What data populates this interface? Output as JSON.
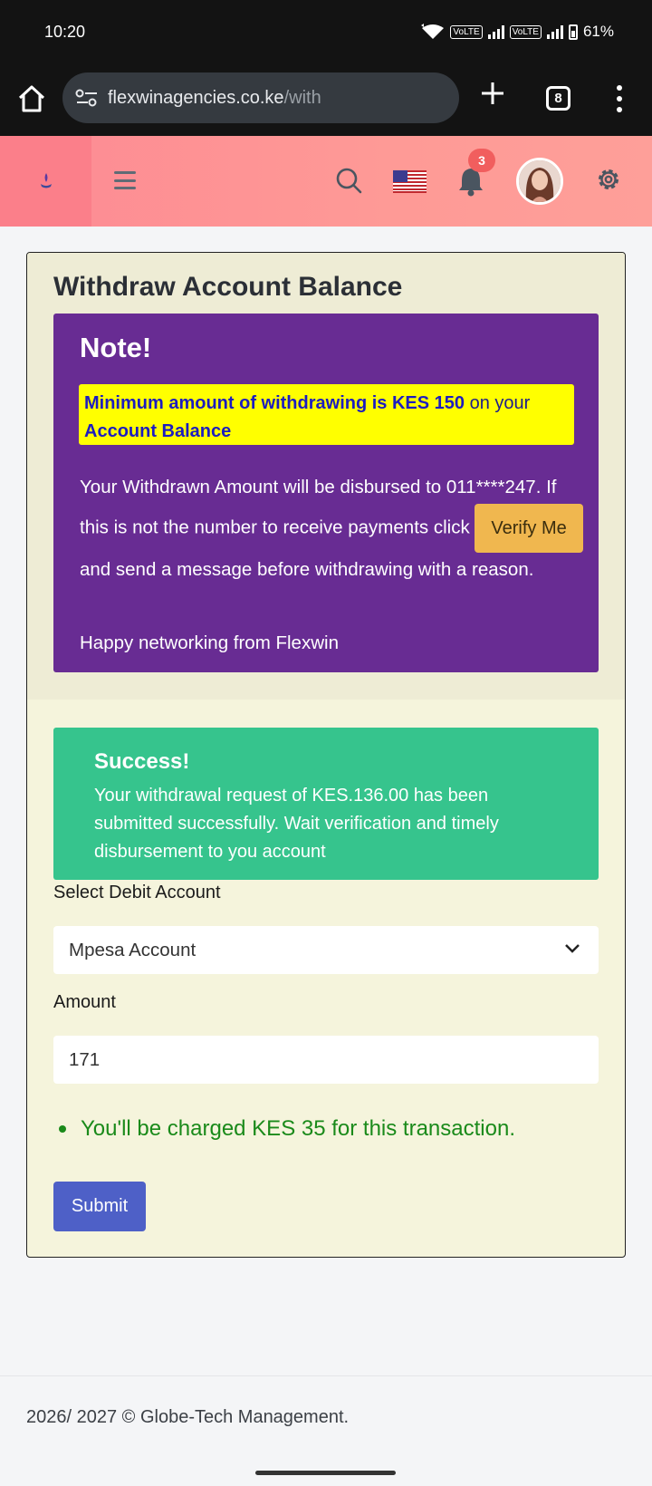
{
  "status_bar": {
    "time": "10:20",
    "volte_1": "VoLTE",
    "volte_2": "VoLTE",
    "battery": "61%"
  },
  "browser": {
    "url_host": "flexwinagencies.co.ke",
    "url_path": "/with",
    "tab_count": "8"
  },
  "header": {
    "notification_count": "3",
    "icons": [
      "logo-icon",
      "menu-icon",
      "search-icon",
      "us-flag-icon",
      "bell-icon",
      "avatar",
      "gear-icon"
    ]
  },
  "main": {
    "title": "Withdraw Account Balance",
    "note": {
      "title": "Note!",
      "highlight_bold_1": "Minimum amount of withdrawing is KES 150",
      "highlight_plain": " on your ",
      "highlight_bold_2": "Account Balance",
      "body_1": "Your Withdrawn Amount will be disbursed to 011****247. If this is not the number to receive payments click",
      "verify_label": "Verify Me",
      "body_2": " and send a message before withdrawing with a reason.",
      "footer": "Happy networking from Flexwin"
    },
    "success": {
      "title": "Success!",
      "message": "Your withdrawal request of KES.136.00 has been submitted successfully. Wait verification and timely disbursement to you account"
    },
    "form": {
      "debit_label": "Select Debit Account",
      "debit_value": "Mpesa Account",
      "amount_label": "Amount",
      "amount_value": "171",
      "charge_note": "You'll be charged KES 35 for this transaction.",
      "submit_label": "Submit"
    }
  },
  "footer": {
    "text": "2026/ 2027 © Globe-Tech Management."
  },
  "colors": {
    "header_bg": "#fe9a96",
    "note_bg": "#682c93",
    "highlight_bg": "#ffff00",
    "success_bg": "#36c48d",
    "verify_bg": "#f0b74f",
    "submit_bg": "#4e60c7",
    "charge_text": "#1a8a1a"
  }
}
